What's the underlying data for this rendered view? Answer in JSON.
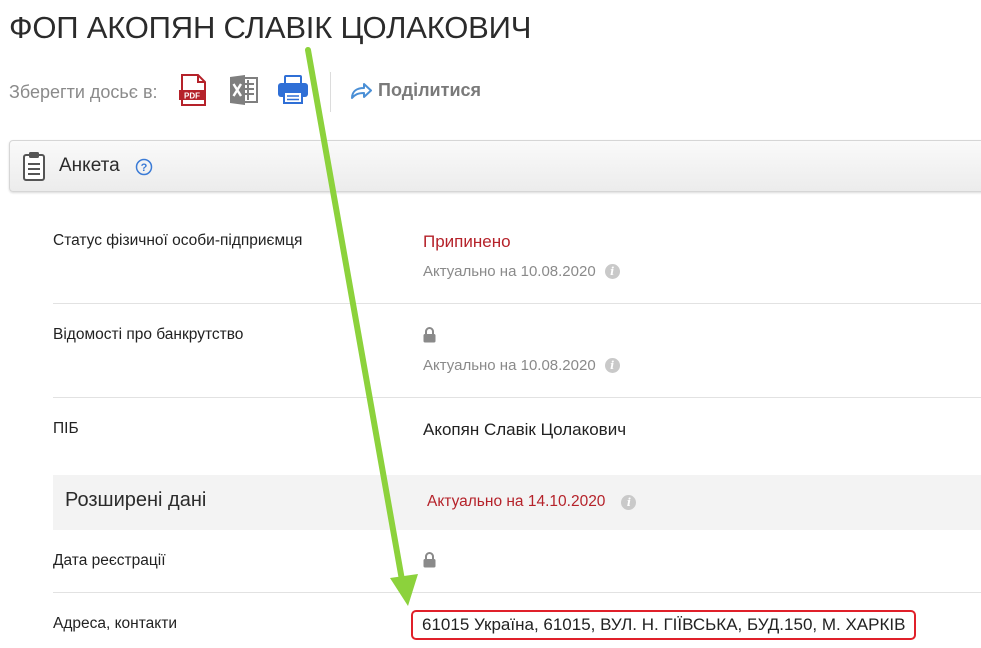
{
  "page": {
    "title": "ФОП АКОПЯН СЛАВІК ЦОЛАКОВИЧ"
  },
  "toolbar": {
    "save_label": "Зберегти досьє в:",
    "pdf_icon_text": "PDF",
    "share_label": "Поділитися"
  },
  "panel": {
    "title": "Анкета"
  },
  "rows": {
    "status": {
      "label": "Статус фізичної особи-підприємця",
      "value": "Припинено",
      "actual": "Актуально на 10.08.2020"
    },
    "bankruptcy": {
      "label": "Відомості про банкрутство",
      "actual": "Актуально на 10.08.2020"
    },
    "pib": {
      "label": "ПІБ",
      "value": "Акопян Славік Цолакович"
    },
    "extended": {
      "title": "Розширені дані",
      "actual": "Актуально на 14.10.2020"
    },
    "reg_date": {
      "label": "Дата реєстрації"
    },
    "address": {
      "label": "Адреса, контакти",
      "value": "61015 Україна, 61015, ВУЛ. Н. ГІЇВСЬКА, БУД.150, М. ХАРКІВ"
    }
  },
  "colors": {
    "status_red": "#b5222a",
    "highlight_border": "#e0202a",
    "annotation_arrow": "#8cd23c",
    "share_blue": "#4a8fd6"
  }
}
